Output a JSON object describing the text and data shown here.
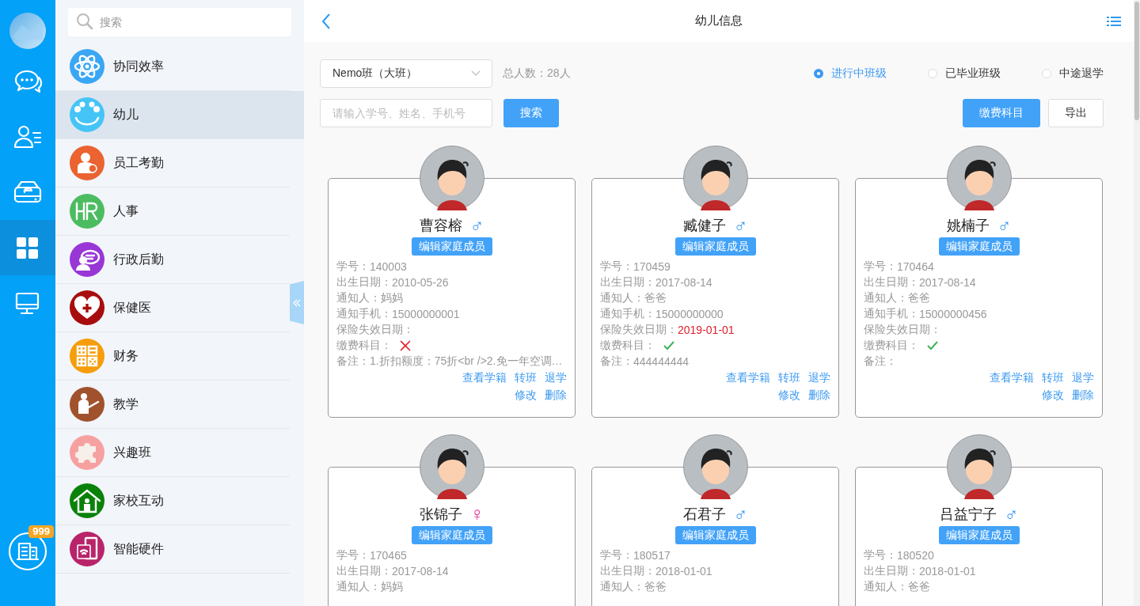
{
  "rail": {
    "items": [
      {
        "kind": "chat",
        "selected": false
      },
      {
        "kind": "contacts",
        "selected": false
      },
      {
        "kind": "drive",
        "selected": false
      },
      {
        "kind": "apps",
        "selected": true
      },
      {
        "kind": "desktop",
        "selected": false
      }
    ],
    "bottom": {
      "kind": "building",
      "badge": "999"
    }
  },
  "sidebar": {
    "search": {
      "placeholder": "搜索"
    },
    "items": [
      {
        "label": "协同效率",
        "kind": "atom",
        "color": "#3aa7f5",
        "selected": false
      },
      {
        "label": "幼儿",
        "kind": "smiley",
        "color": "#45c4f7",
        "selected": true
      },
      {
        "label": "员工考勤",
        "kind": "attendance",
        "color": "#ea6330",
        "selected": false
      },
      {
        "label": "人事",
        "kind": "hr",
        "color": "#4cbc61",
        "selected": false
      },
      {
        "label": "行政后勤",
        "kind": "admin",
        "color": "#9836d6",
        "selected": false
      },
      {
        "label": "保健医",
        "kind": "health",
        "color": "#a80d0d",
        "selected": false
      },
      {
        "label": "财务",
        "kind": "finance",
        "color": "#f59d0a",
        "selected": false
      },
      {
        "label": "教学",
        "kind": "teach",
        "color": "#a0522d",
        "selected": false
      },
      {
        "label": "兴趣班",
        "kind": "puzzle",
        "color": "#f7a0a0",
        "selected": false
      },
      {
        "label": "家校互动",
        "kind": "home",
        "color": "#0a820a",
        "selected": false
      },
      {
        "label": "智能硬件",
        "kind": "hardware",
        "color": "#b8246a",
        "selected": false
      }
    ]
  },
  "header": {
    "title": "幼儿信息"
  },
  "filters": {
    "class_select": "Nemo班（大班）",
    "total": "总人数：28人",
    "radios": [
      {
        "label": "进行中班级",
        "selected": true
      },
      {
        "label": "已毕业班级",
        "selected": false
      },
      {
        "label": "中途退学",
        "selected": false
      }
    ],
    "search_placeholder": "请输入学号、姓名、手机号",
    "search_button": "搜索",
    "buttons": [
      {
        "label": "缴费科目",
        "kind": "primary"
      },
      {
        "label": "导出",
        "kind": "plain"
      }
    ]
  },
  "cards": [
    {
      "name": "曹容榕",
      "gender": "♂",
      "kind": "male",
      "edit": "编辑家庭成员",
      "fields": [
        {
          "label": "学号：",
          "value": "140003"
        },
        {
          "label": "出生日期：",
          "value": "2010-05-26"
        },
        {
          "label": "通知人：",
          "value": "妈妈"
        },
        {
          "label": "通知手机：",
          "value": "15000000001"
        },
        {
          "label": "保险失效日期："
        },
        {
          "label": "缴费科目：",
          "paid": false
        },
        {
          "label": "备注：",
          "value": "1.折扣额度：75折<br />2.免一年空调…"
        }
      ],
      "links": [
        [
          "查看学籍",
          "转班",
          "退学"
        ],
        [
          "修改",
          "删除"
        ]
      ]
    },
    {
      "name": "臧健子",
      "gender": "♂",
      "kind": "male",
      "edit": "编辑家庭成员",
      "fields": [
        {
          "label": "学号：",
          "value": "170459"
        },
        {
          "label": "出生日期：",
          "value": "2017-08-14"
        },
        {
          "label": "通知人：",
          "value": "爸爸"
        },
        {
          "label": "通知手机：",
          "value": "15000000000"
        },
        {
          "label": "保险失效日期：",
          "value": "2019-01-01",
          "alert": true
        },
        {
          "label": "缴费科目：",
          "paid": true
        },
        {
          "label": "备注：",
          "value": "444444444"
        }
      ],
      "links": [
        [
          "查看学籍",
          "转班",
          "退学"
        ],
        [
          "修改",
          "删除"
        ]
      ]
    },
    {
      "name": "姚楠子",
      "gender": "♂",
      "kind": "male",
      "edit": "编辑家庭成员",
      "fields": [
        {
          "label": "学号：",
          "value": "170464"
        },
        {
          "label": "出生日期：",
          "value": "2017-08-14"
        },
        {
          "label": "通知人：",
          "value": "爸爸"
        },
        {
          "label": "通知手机：",
          "value": "15000000456"
        },
        {
          "label": "保险失效日期："
        },
        {
          "label": "缴费科目：",
          "paid": true
        },
        {
          "label": "备注："
        }
      ],
      "links": [
        [
          "查看学籍",
          "转班",
          "退学"
        ],
        [
          "修改",
          "删除"
        ]
      ]
    },
    {
      "name": "张锦子",
      "gender": "♀",
      "kind": "female",
      "edit": "编辑家庭成员",
      "fields": [
        {
          "label": "学号：",
          "value": "170465"
        },
        {
          "label": "出生日期：",
          "value": "2017-08-14"
        },
        {
          "label": "通知人：",
          "value": "妈妈"
        }
      ]
    },
    {
      "name": "石君子",
      "gender": "♂",
      "kind": "male",
      "edit": "编辑家庭成员",
      "fields": [
        {
          "label": "学号：",
          "value": "180517"
        },
        {
          "label": "出生日期：",
          "value": "2018-01-01"
        },
        {
          "label": "通知人：",
          "value": "爸爸"
        }
      ]
    },
    {
      "name": "吕益宁子",
      "gender": "♂",
      "kind": "male",
      "edit": "编辑家庭成员",
      "fields": [
        {
          "label": "学号：",
          "value": "180520"
        },
        {
          "label": "出生日期：",
          "value": "2018-01-01"
        },
        {
          "label": "通知人：",
          "value": "爸爸"
        }
      ]
    }
  ]
}
